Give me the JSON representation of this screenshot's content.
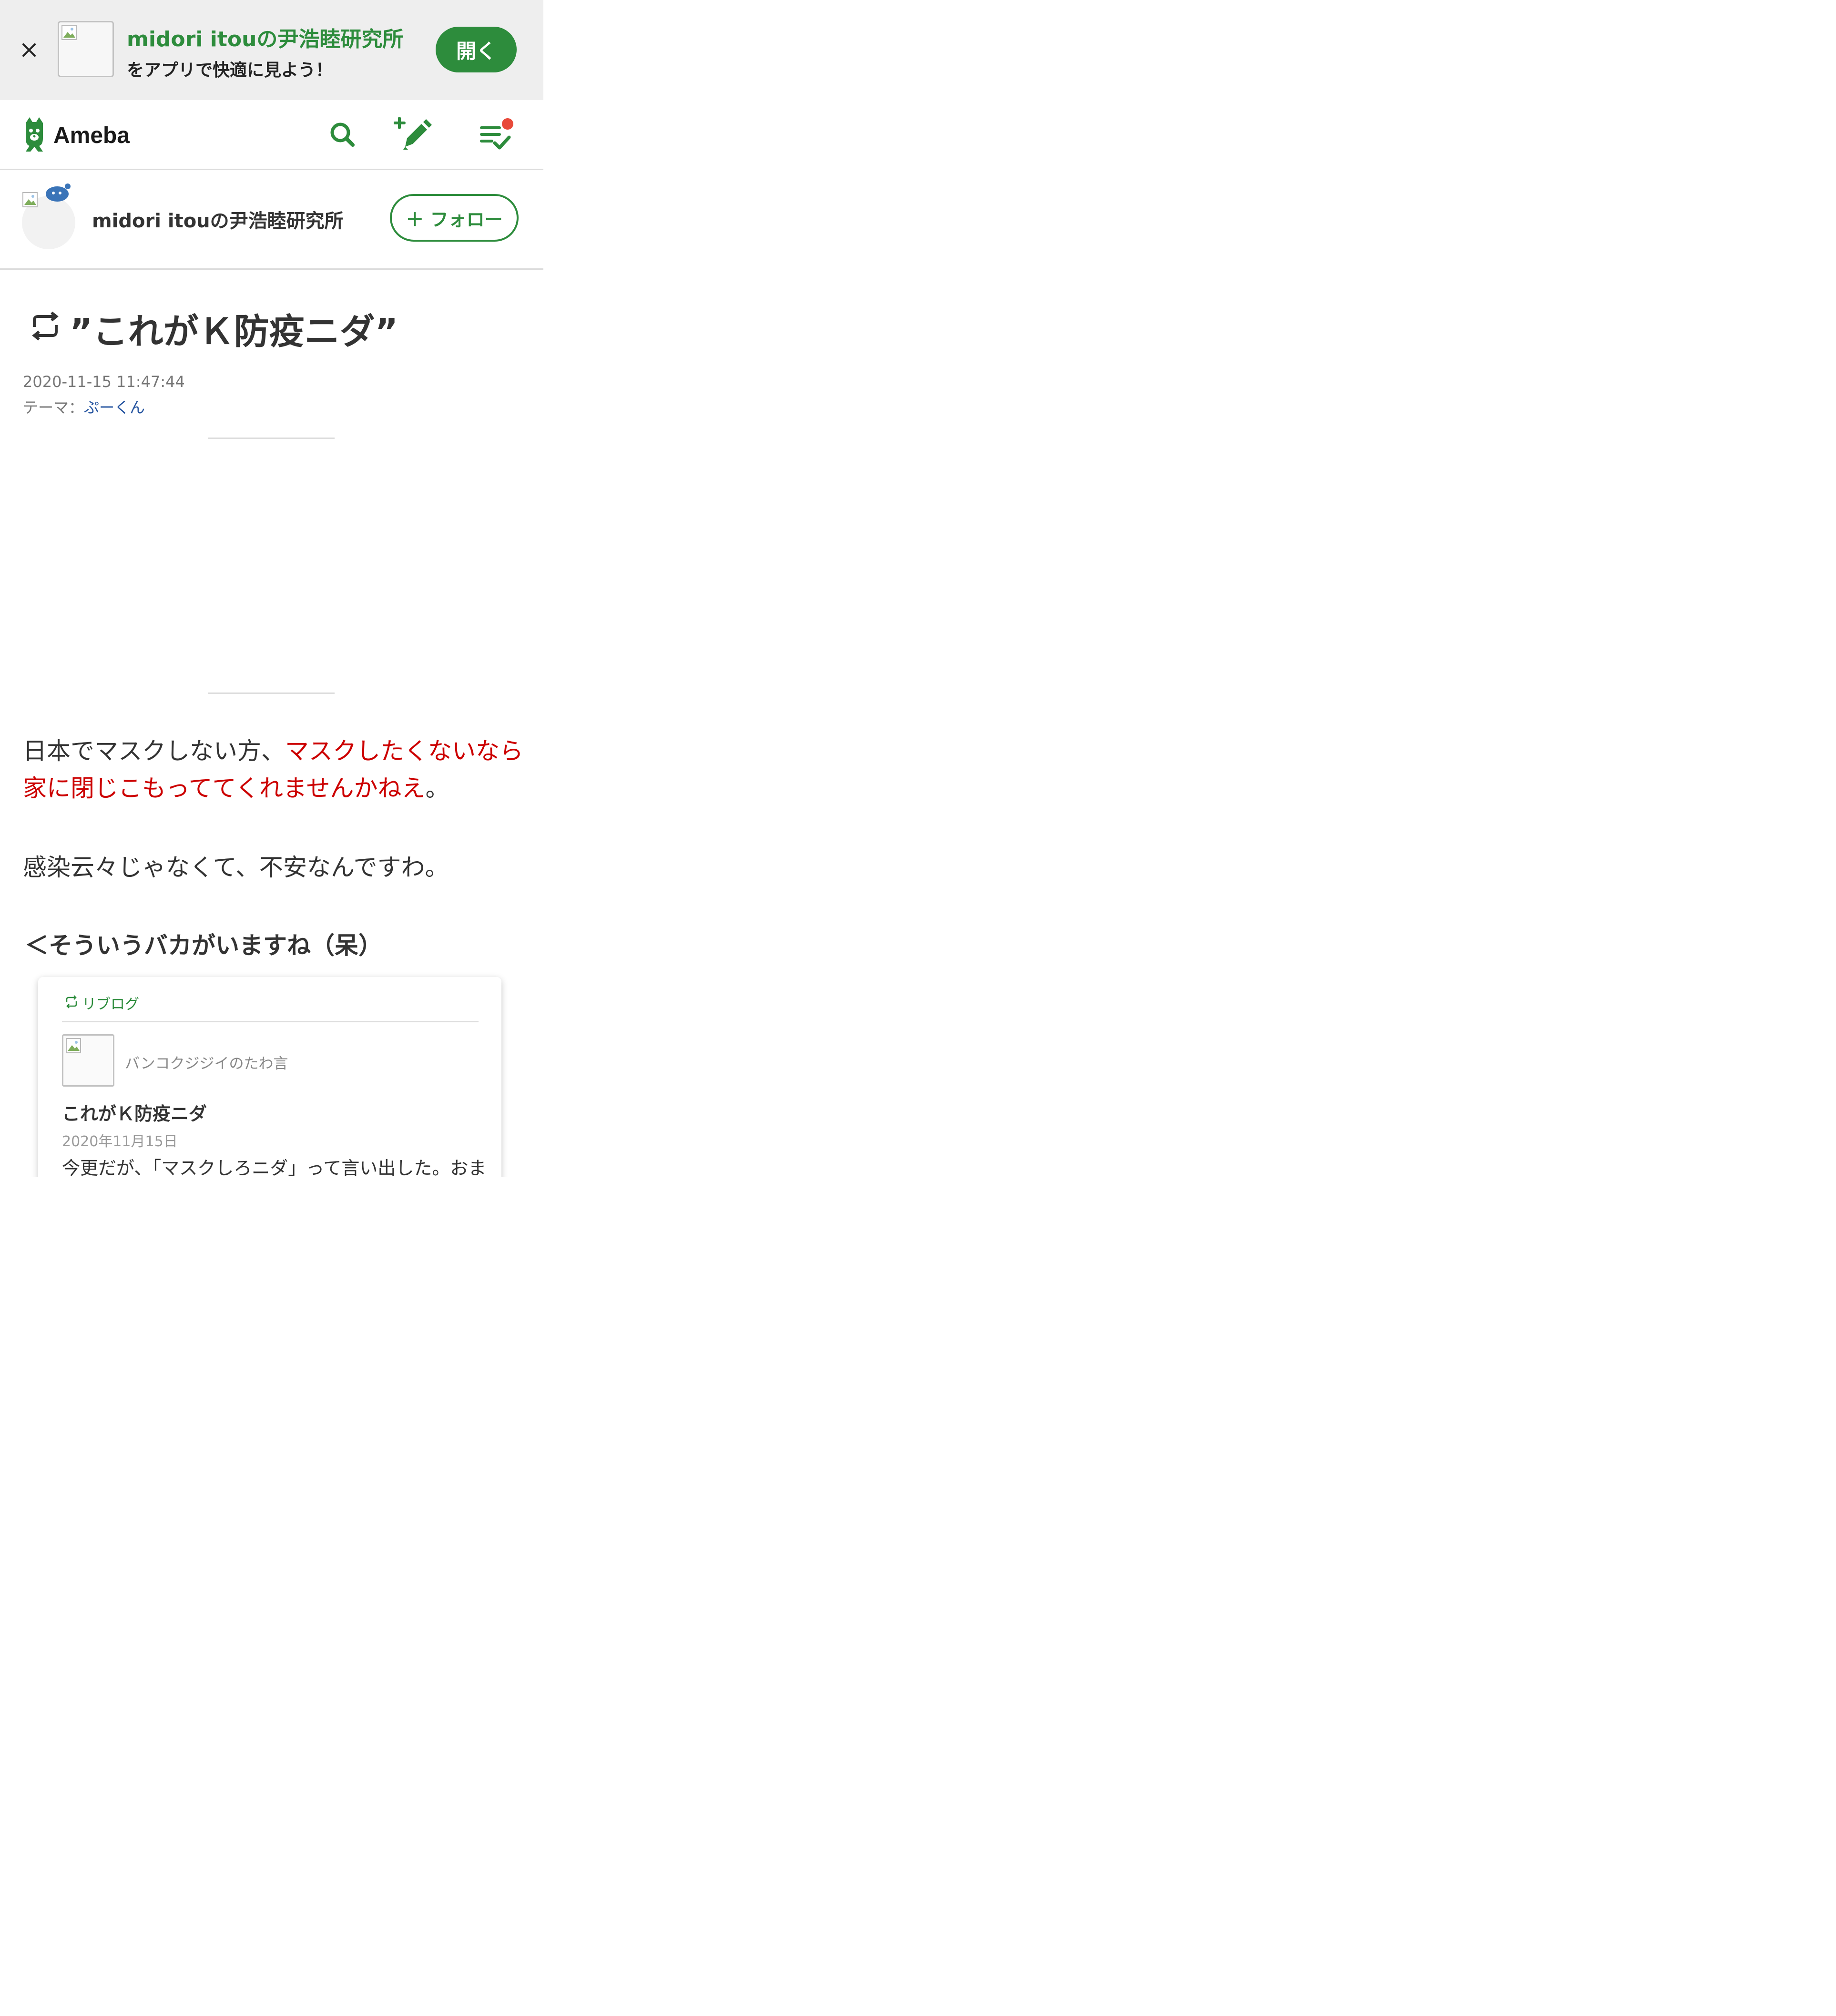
{
  "banner": {
    "title": "midori itouの尹浩睦研究所",
    "subtitle": "をアプリで快適に見よう！",
    "open_label": "開く"
  },
  "header": {
    "logo_text": "Ameba"
  },
  "blog": {
    "name": "midori itouの尹浩睦研究所",
    "follow_label": "＋ フォロー"
  },
  "article": {
    "title": "”これがＫ防疫ニダ”",
    "date": "2020-11-15 11:47:44",
    "theme_prefix": "テーマ：",
    "theme": "ぷーくん",
    "line1_plain": "日本でマスクしない方、",
    "line1_red": "マスクしたくないなら",
    "line2_red": "家に閉じこもっててくれませんかねえ",
    "line2_plain": "。",
    "line3": "感染云々じゃなくて、不安なんですわ。",
    "line4": "＜そういうバカがいますね（呆）"
  },
  "reblog_card": {
    "label": "リブログ",
    "blog_name": "バンコクジジイのたわ言",
    "title": "これがＫ防疫ニダ",
    "date": "2020年11月15日",
    "excerpt": "今更だが、「マスクしろニダ」って言い出した。おま"
  },
  "colors": {
    "accent_green": "#2d8c3c",
    "highlight_red": "#cc0000",
    "link_blue": "#2554a0",
    "notification_red": "#e84a3a"
  }
}
